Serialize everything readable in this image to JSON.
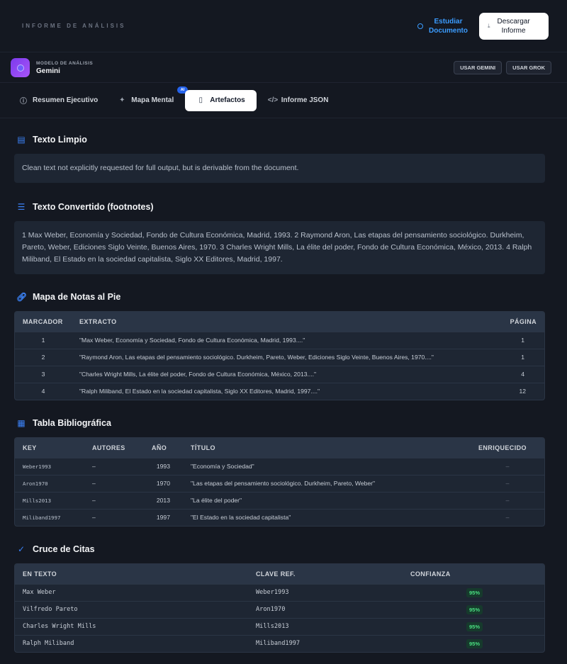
{
  "header": {
    "kicker": "INFORME DE ANÁLISIS",
    "study_line1": "Estudiar",
    "study_line2": "Documento",
    "download_line1": "Descargar",
    "download_line2": "Informe"
  },
  "model": {
    "kicker": "MODELO DE ANÁLISIS",
    "name": "Gemini",
    "btn_gemini": "USAR GEMINI",
    "btn_grok": "USAR GROK"
  },
  "tabs": [
    {
      "label": "Resumen Ejecutivo",
      "icon": "info-icon"
    },
    {
      "label": "Mapa Mental",
      "icon": "sparkles-icon",
      "badge": "AI"
    },
    {
      "label": "Artefactos",
      "icon": "document-icon",
      "active": true
    },
    {
      "label": "Informe JSON",
      "icon": "code-icon"
    }
  ],
  "clean_text": {
    "title": "Texto Limpio",
    "body": "Clean text not explicitly requested for full output, but is derivable from the document."
  },
  "converted": {
    "title": "Texto Convertido (footnotes)",
    "body": "1 Max Weber, Economía y Sociedad, Fondo de Cultura Económica, Madrid, 1993. 2 Raymond Aron, Las etapas del pensamiento sociológico. Durkheim, Pareto, Weber, Ediciones Siglo Veinte, Buenos Aires, 1970. 3 Charles Wright Mills, La élite del poder, Fondo de Cultura Económica, México, 2013. 4 Ralph Miliband, El Estado en la sociedad capitalista, Siglo XX Editores, Madrid, 1997."
  },
  "footnotes": {
    "title": "Mapa de Notas al Pie",
    "headers": [
      "MARCADOR",
      "EXTRACTO",
      "PÁGINA"
    ],
    "rows": [
      {
        "marker": "1",
        "excerpt": "\"Max Weber, Economía y Sociedad, Fondo de Cultura Económica, Madrid, 1993....\"",
        "page": "1"
      },
      {
        "marker": "2",
        "excerpt": "\"Raymond Aron, Las etapas del pensamiento sociológico. Durkheim, Pareto, Weber, Ediciones Siglo Veinte, Buenos Aires, 1970....\"",
        "page": "1"
      },
      {
        "marker": "3",
        "excerpt": "\"Charles Wright Mills, La élite del poder, Fondo de Cultura Económica, México, 2013....\"",
        "page": "4"
      },
      {
        "marker": "4",
        "excerpt": "\"Ralph Miliband, El Estado en la sociedad capitalista, Siglo XX Editores, Madrid, 1997....\"",
        "page": "12"
      }
    ]
  },
  "bibliography": {
    "title": "Tabla Bibliográfica",
    "headers": [
      "KEY",
      "AUTORES",
      "AÑO",
      "TÍTULO",
      "ENRIQUECIDO"
    ],
    "rows": [
      {
        "key": "Weber1993",
        "authors": "–",
        "year": "1993",
        "title": "\"Economía y Sociedad\"",
        "enriched": "–"
      },
      {
        "key": "Aron1970",
        "authors": "–",
        "year": "1970",
        "title": "\"Las etapas del pensamiento sociológico. Durkheim, Pareto, Weber\"",
        "enriched": "–"
      },
      {
        "key": "Mills2013",
        "authors": "–",
        "year": "2013",
        "title": "\"La élite del poder\"",
        "enriched": "–"
      },
      {
        "key": "Miliband1997",
        "authors": "–",
        "year": "1997",
        "title": "\"El Estado en la sociedad capitalista\"",
        "enriched": "–"
      }
    ]
  },
  "citations": {
    "title": "Cruce de Citas",
    "headers": [
      "EN TEXTO",
      "CLAVE REF.",
      "CONFIANZA"
    ],
    "rows": [
      {
        "text": "Max Weber",
        "ref": "Weber1993",
        "confidence": "95%"
      },
      {
        "text": "Vilfredo Pareto",
        "ref": "Aron1970",
        "confidence": "95%"
      },
      {
        "text": "Charles Wright Mills",
        "ref": "Mills2013",
        "confidence": "95%"
      },
      {
        "text": "Ralph Miliband",
        "ref": "Miliband1997",
        "confidence": "95%"
      }
    ]
  },
  "colors": {
    "accent": "#3b82f6",
    "background": "#141821",
    "confidence_badge": "#4ade80"
  }
}
